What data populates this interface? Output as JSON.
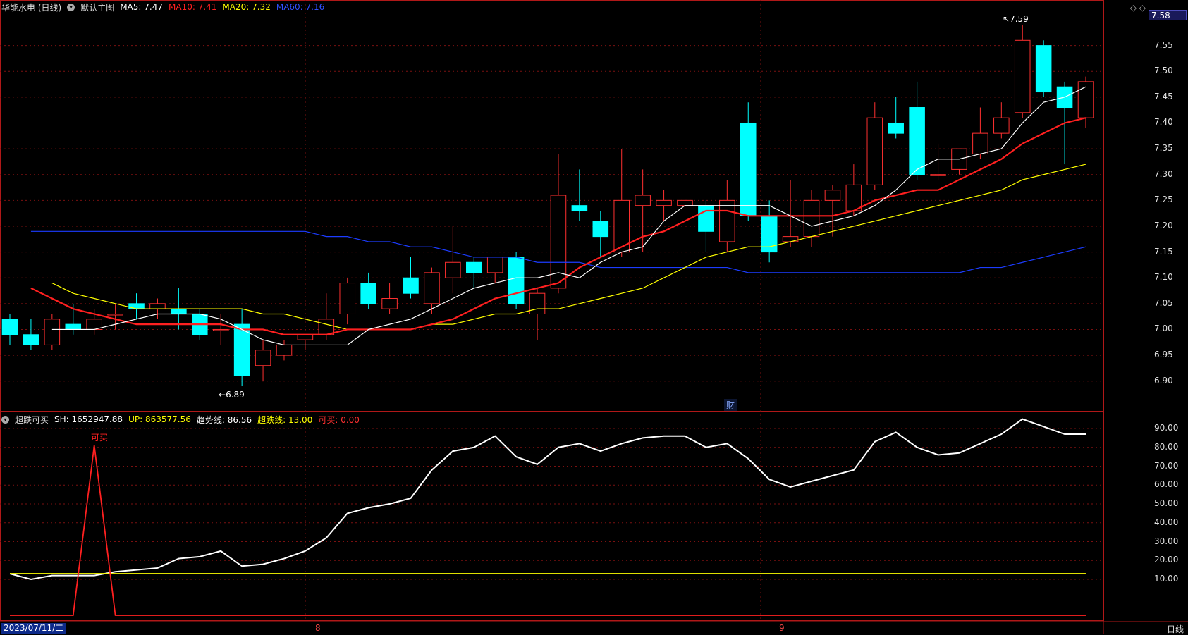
{
  "main_panel": {
    "title": "华能水电 (日线)",
    "template_label": "默认主图",
    "ma": [
      {
        "label": "MA5:",
        "value": "7.47",
        "color": "#ffffff"
      },
      {
        "label": "MA10:",
        "value": "7.41",
        "color": "#ff2020"
      },
      {
        "label": "MA20:",
        "value": "7.32",
        "color": "#ffff00"
      },
      {
        "label": "MA60:",
        "value": "7.16",
        "color": "#1c3cff"
      }
    ],
    "current_price": "7.58",
    "high_marker": "7.59",
    "low_marker": "6.89",
    "finance_marker": "财",
    "corner_icons": "◇ ◇",
    "price_ticks": [
      "7.55",
      "7.50",
      "7.45",
      "7.40",
      "7.35",
      "7.30",
      "7.25",
      "7.20",
      "7.15",
      "7.10",
      "7.05",
      "7.00",
      "6.95",
      "6.90"
    ]
  },
  "indicator_panel": {
    "name": "超跌可买",
    "values": [
      {
        "label": "SH:",
        "value": "1652947.88",
        "color": "#ffffff"
      },
      {
        "label": "UP:",
        "value": "863577.56",
        "color": "#ffff00"
      },
      {
        "label": "趋势线:",
        "value": "86.56",
        "color": "#ffffff"
      },
      {
        "label": "超跌线:",
        "value": "13.00",
        "color": "#ffff00"
      },
      {
        "label": "可买:",
        "value": "0.00",
        "color": "#ff3030"
      }
    ],
    "signal_label": "可买",
    "ticks": [
      "90.00",
      "80.00",
      "70.00",
      "60.00",
      "50.00",
      "40.00",
      "30.00",
      "20.00",
      "10.00"
    ]
  },
  "bottom_bar": {
    "date": "2023/07/11/二",
    "months": [
      "8",
      "9"
    ],
    "period": "日线"
  },
  "colors": {
    "up": "#ff3030",
    "down": "#00ffff",
    "grid": "#7a1010",
    "border": "#b01818"
  },
  "chart_data": [
    {
      "type": "candlestick",
      "title": "华能水电 (日线)",
      "ylim": [
        6.86,
        7.6
      ],
      "series_fields": [
        "open",
        "high",
        "low",
        "close"
      ],
      "candles": [
        [
          7.02,
          7.03,
          6.97,
          6.99
        ],
        [
          6.99,
          7.02,
          6.96,
          6.97
        ],
        [
          6.97,
          7.03,
          6.96,
          7.02
        ],
        [
          7.01,
          7.05,
          6.99,
          7.0
        ],
        [
          7.0,
          7.04,
          6.99,
          7.02
        ],
        [
          7.03,
          7.05,
          7.0,
          7.03
        ],
        [
          7.05,
          7.07,
          7.02,
          7.04
        ],
        [
          7.04,
          7.06,
          7.02,
          7.05
        ],
        [
          7.04,
          7.08,
          7.0,
          7.03
        ],
        [
          7.03,
          7.04,
          6.98,
          6.99
        ],
        [
          7.0,
          7.03,
          6.97,
          7.0
        ],
        [
          7.01,
          7.04,
          6.89,
          6.91
        ],
        [
          6.93,
          6.98,
          6.9,
          6.96
        ],
        [
          6.95,
          6.98,
          6.94,
          6.97
        ],
        [
          6.98,
          6.99,
          6.96,
          6.99
        ],
        [
          6.99,
          7.07,
          6.98,
          7.02
        ],
        [
          7.03,
          7.1,
          7.01,
          7.09
        ],
        [
          7.09,
          7.11,
          7.04,
          7.05
        ],
        [
          7.04,
          7.09,
          7.03,
          7.06
        ],
        [
          7.1,
          7.14,
          7.06,
          7.07
        ],
        [
          7.05,
          7.12,
          7.03,
          7.11
        ],
        [
          7.1,
          7.2,
          7.07,
          7.13
        ],
        [
          7.13,
          7.14,
          7.08,
          7.11
        ],
        [
          7.11,
          7.14,
          7.09,
          7.14
        ],
        [
          7.14,
          7.15,
          7.04,
          7.05
        ],
        [
          7.03,
          7.08,
          6.98,
          7.07
        ],
        [
          7.08,
          7.34,
          7.07,
          7.26
        ],
        [
          7.24,
          7.31,
          7.21,
          7.23
        ],
        [
          7.21,
          7.23,
          7.14,
          7.18
        ],
        [
          7.15,
          7.35,
          7.14,
          7.25
        ],
        [
          7.24,
          7.31,
          7.15,
          7.26
        ],
        [
          7.24,
          7.27,
          7.21,
          7.25
        ],
        [
          7.24,
          7.33,
          7.19,
          7.25
        ],
        [
          7.24,
          7.25,
          7.15,
          7.19
        ],
        [
          7.17,
          7.29,
          7.15,
          7.25
        ],
        [
          7.4,
          7.44,
          7.21,
          7.22
        ],
        [
          7.22,
          7.25,
          7.13,
          7.15
        ],
        [
          7.17,
          7.29,
          7.16,
          7.18
        ],
        [
          7.18,
          7.27,
          7.16,
          7.25
        ],
        [
          7.25,
          7.28,
          7.18,
          7.27
        ],
        [
          7.23,
          7.32,
          7.22,
          7.28
        ],
        [
          7.28,
          7.44,
          7.27,
          7.41
        ],
        [
          7.4,
          7.45,
          7.37,
          7.38
        ],
        [
          7.43,
          7.48,
          7.29,
          7.3
        ],
        [
          7.3,
          7.36,
          7.29,
          7.3
        ],
        [
          7.31,
          7.35,
          7.3,
          7.35
        ],
        [
          7.34,
          7.43,
          7.33,
          7.38
        ],
        [
          7.38,
          7.44,
          7.37,
          7.41
        ],
        [
          7.42,
          7.59,
          7.41,
          7.56
        ],
        [
          7.55,
          7.56,
          7.45,
          7.46
        ],
        [
          7.47,
          7.48,
          7.32,
          7.43
        ],
        [
          7.41,
          7.49,
          7.39,
          7.48
        ]
      ],
      "ma5": [
        7.0,
        7.0,
        7.0,
        7.01,
        7.02,
        7.03,
        7.03,
        7.03,
        7.02,
        7.0,
        6.98,
        6.97,
        6.97,
        6.97,
        6.97,
        7.0,
        7.01,
        7.02,
        7.04,
        7.06,
        7.08,
        7.09,
        7.1,
        7.1,
        7.11,
        7.1,
        7.13,
        7.15,
        7.16,
        7.21,
        7.24,
        7.24,
        7.24,
        7.24,
        7.24,
        7.22,
        7.2,
        7.21,
        7.22,
        7.24,
        7.27,
        7.31,
        7.33,
        7.33,
        7.34,
        7.35,
        7.4,
        7.44,
        7.45,
        7.47
      ],
      "ma10": [
        7.08,
        7.06,
        7.04,
        7.03,
        7.02,
        7.01,
        7.01,
        7.01,
        7.01,
        7.01,
        7.0,
        7.0,
        6.99,
        6.99,
        6.99,
        7.0,
        7.0,
        7.0,
        7.0,
        7.01,
        7.02,
        7.04,
        7.06,
        7.07,
        7.08,
        7.09,
        7.12,
        7.14,
        7.16,
        7.18,
        7.19,
        7.21,
        7.23,
        7.23,
        7.22,
        7.22,
        7.22,
        7.22,
        7.22,
        7.23,
        7.25,
        7.26,
        7.27,
        7.27,
        7.29,
        7.31,
        7.33,
        7.36,
        7.38,
        7.4,
        7.41
      ],
      "ma20": [
        7.09,
        7.07,
        7.06,
        7.05,
        7.04,
        7.04,
        7.04,
        7.04,
        7.04,
        7.04,
        7.03,
        7.03,
        7.02,
        7.01,
        7.0,
        7.0,
        7.0,
        7.0,
        7.01,
        7.01,
        7.02,
        7.03,
        7.03,
        7.04,
        7.04,
        7.05,
        7.06,
        7.07,
        7.08,
        7.1,
        7.12,
        7.14,
        7.15,
        7.16,
        7.16,
        7.17,
        7.18,
        7.19,
        7.2,
        7.21,
        7.22,
        7.23,
        7.24,
        7.25,
        7.26,
        7.27,
        7.29,
        7.3,
        7.31,
        7.32
      ],
      "ma60": [
        7.19,
        7.19,
        7.19,
        7.19,
        7.19,
        7.19,
        7.19,
        7.19,
        7.19,
        7.19,
        7.19,
        7.19,
        7.19,
        7.19,
        7.18,
        7.18,
        7.17,
        7.17,
        7.16,
        7.16,
        7.15,
        7.14,
        7.14,
        7.14,
        7.13,
        7.13,
        7.13,
        7.12,
        7.12,
        7.12,
        7.12,
        7.12,
        7.12,
        7.12,
        7.11,
        7.11,
        7.11,
        7.11,
        7.11,
        7.11,
        7.11,
        7.11,
        7.11,
        7.11,
        7.11,
        7.12,
        7.12,
        7.13,
        7.14,
        7.15,
        7.16
      ]
    },
    {
      "type": "line",
      "title": "超跌可买",
      "ylim": [
        5,
        97
      ],
      "series": [
        {
          "name": "趋势线",
          "color": "#ffffff",
          "values": [
            13,
            10,
            12,
            12,
            12,
            14,
            15,
            16,
            21,
            22,
            25,
            17,
            18,
            21,
            25,
            32,
            45,
            48,
            50,
            53,
            68,
            78,
            80,
            86,
            75,
            71,
            80,
            82,
            78,
            82,
            85,
            86,
            86,
            80,
            82,
            74,
            63,
            59,
            62,
            65,
            68,
            83,
            88,
            80,
            76,
            77,
            82,
            87,
            95,
            91,
            87,
            87
          ]
        },
        {
          "name": "超跌线",
          "color": "#ffff00",
          "values": [
            13,
            13,
            13,
            13,
            13,
            13,
            13,
            13,
            13,
            13,
            13,
            13,
            13,
            13,
            13,
            13,
            13,
            13,
            13,
            13,
            13,
            13,
            13,
            13,
            13,
            13,
            13,
            13,
            13,
            13,
            13,
            13,
            13,
            13,
            13,
            13,
            13,
            13,
            13,
            13,
            13,
            13,
            13,
            13,
            13,
            13,
            13,
            13,
            13,
            13,
            13,
            13
          ]
        },
        {
          "name": "可买",
          "color": "#ff2020",
          "values": [
            0,
            0,
            0,
            0,
            81,
            0,
            0,
            0,
            0,
            0,
            0,
            0,
            0,
            0,
            0,
            0,
            0,
            0,
            0,
            0,
            0,
            0,
            0,
            0,
            0,
            0,
            0,
            0,
            0,
            0,
            0,
            0,
            0,
            0,
            0,
            0,
            0,
            0,
            0,
            0,
            0,
            0,
            0,
            0,
            0,
            0,
            0,
            0,
            0,
            0,
            0,
            0
          ]
        }
      ]
    }
  ]
}
